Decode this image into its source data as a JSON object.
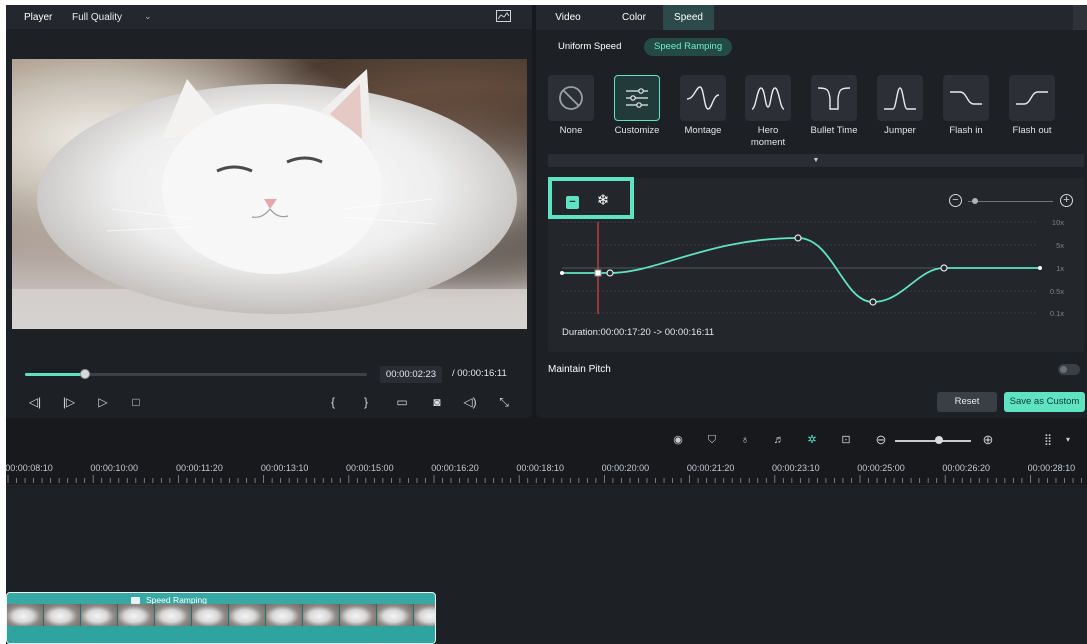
{
  "player": {
    "title": "Player",
    "quality": "Full Quality",
    "current_time": "00:00:02:23",
    "total_time": "/  00:00:16:11",
    "progress": 0.176
  },
  "panel": {
    "tabs": [
      "Video",
      "Color",
      "Speed"
    ],
    "active_tab": "Speed",
    "subtabs": [
      "Uniform Speed",
      "Speed Ramping"
    ],
    "active_subtab": "Speed Ramping",
    "presets": [
      {
        "label": "None",
        "icon": "none-icon"
      },
      {
        "label": "Customize",
        "icon": "customize-sliders-icon",
        "selected": true
      },
      {
        "label": "Montage",
        "icon": "montage-curve-icon"
      },
      {
        "label": "Hero moment",
        "icon": "hero-moment-curve-icon"
      },
      {
        "label": "Bullet Time",
        "icon": "bullet-time-curve-icon"
      },
      {
        "label": "Jumper",
        "icon": "jumper-curve-icon"
      },
      {
        "label": "Flash in",
        "icon": "flash-in-curve-icon"
      },
      {
        "label": "Flash out",
        "icon": "flash-out-curve-icon"
      }
    ],
    "graph": {
      "y_ticks": [
        "10x",
        "5x",
        "1x",
        "0.5x",
        "0.1x"
      ],
      "duration": "Duration:00:00:17:20 -> 00:00:16:11"
    },
    "maintain_pitch": "Maintain Pitch",
    "maintain_pitch_on": false,
    "reset_label": "Reset",
    "save_custom_label": "Save as Custom",
    "minus_label": "−",
    "freeze_label": "❄",
    "zoom_out_label": "−",
    "zoom_in_label": "+"
  },
  "timeline": {
    "ruler_labels": [
      "00:00:08:10",
      "00:00:10:00",
      "00:00:11:20",
      "00:00:13:10",
      "00:00:15:00",
      "00:00:16:20",
      "00:00:18:10",
      "00:00:20:00",
      "00:00:21:20",
      "00:00:23:10",
      "00:00:25:00",
      "00:00:26:20",
      "00:00:28:10"
    ],
    "clip_title": "Speed Ramping"
  },
  "colors": {
    "accent": "#5fe3c2",
    "playhead": "#e0434b",
    "panel_bg": "#1d2025"
  }
}
